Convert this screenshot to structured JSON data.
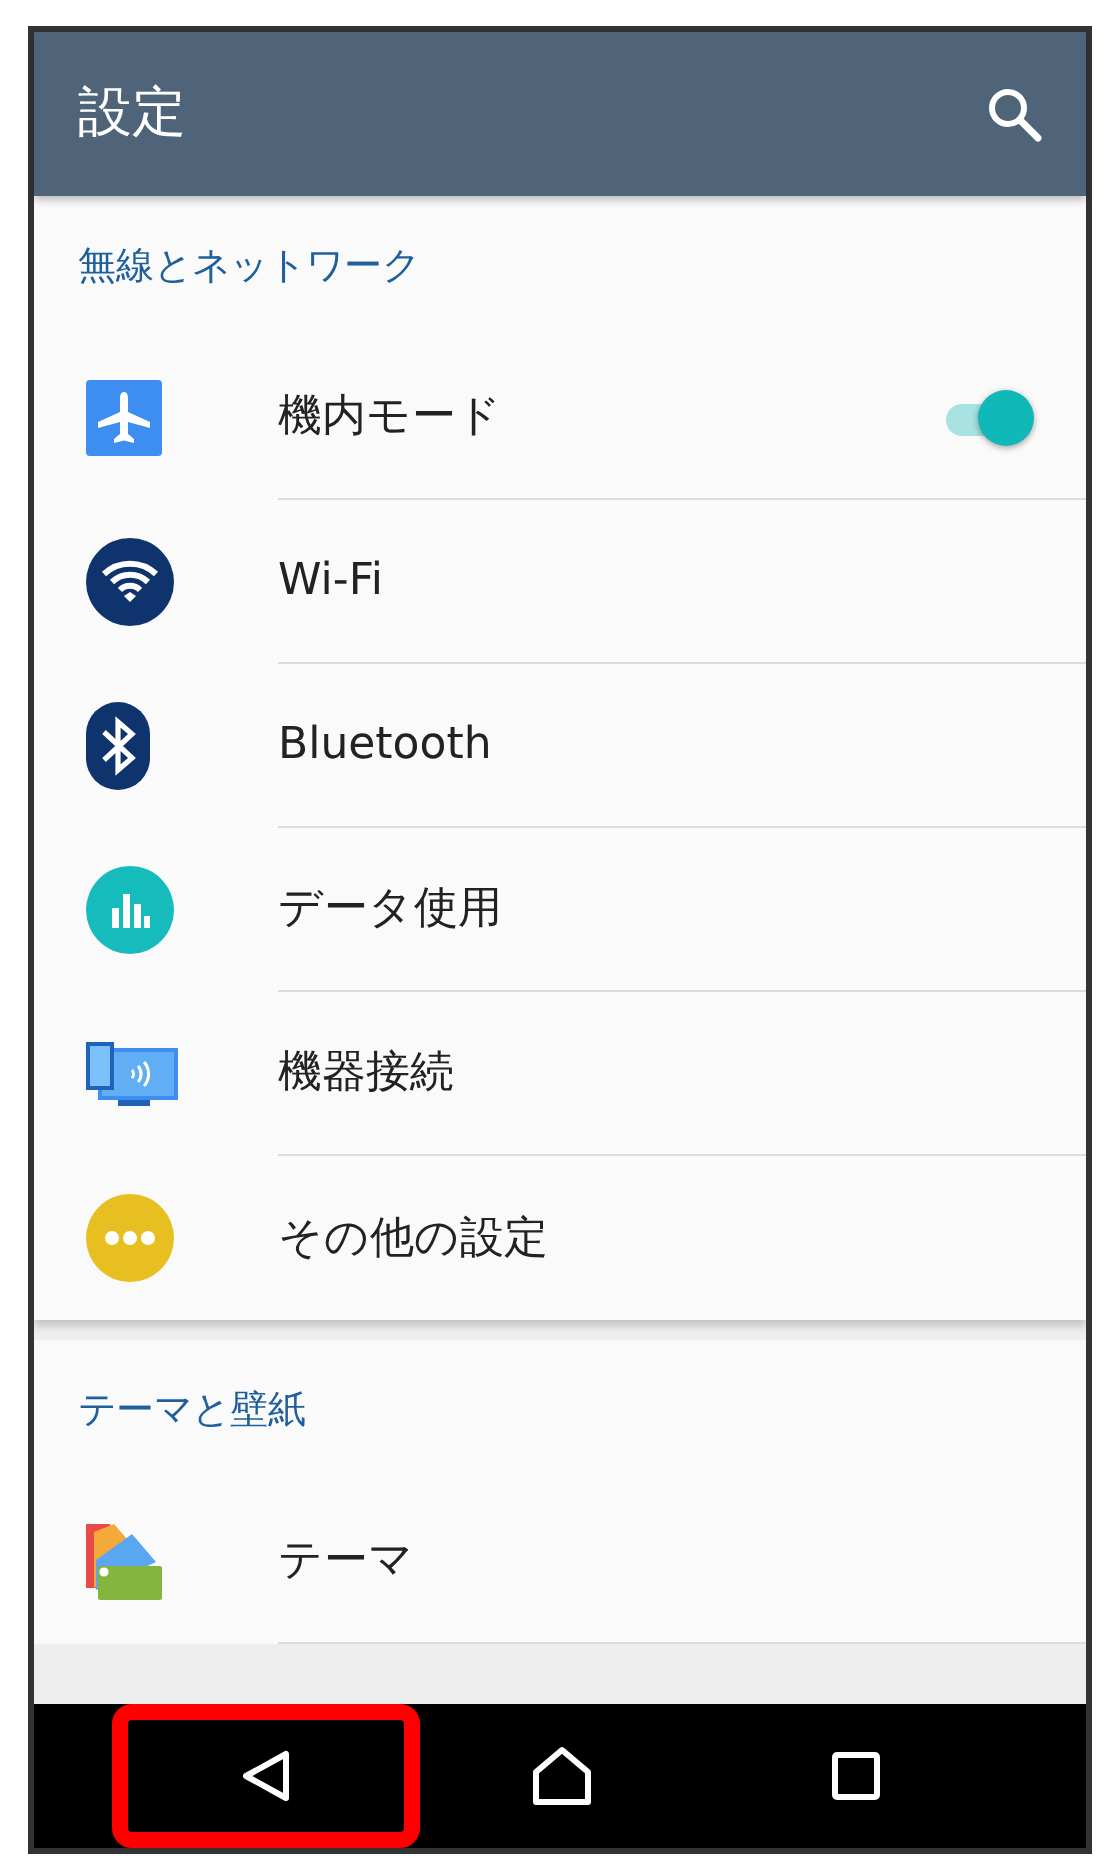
{
  "app_bar": {
    "title": "設定"
  },
  "sections": [
    {
      "header": "無線とネットワーク",
      "ends": true,
      "items": [
        {
          "label": "機内モード",
          "kind": "toggle",
          "on": true
        },
        {
          "label": "Wi-Fi",
          "kind": "link"
        },
        {
          "label": "Bluetooth",
          "kind": "link"
        },
        {
          "label": "データ使用",
          "kind": "link"
        },
        {
          "label": "機器接続",
          "kind": "link"
        },
        {
          "label": "その他の設定",
          "kind": "link"
        }
      ]
    },
    {
      "header": "テーマと壁紙",
      "ends": false,
      "items": [
        {
          "label": "テーマ",
          "kind": "link"
        }
      ]
    }
  ],
  "nav_bar": [
    {
      "kind": "back",
      "highlighted": true
    },
    {
      "kind": "home",
      "highlighted": false
    },
    {
      "kind": "recents",
      "highlighted": false
    }
  ]
}
